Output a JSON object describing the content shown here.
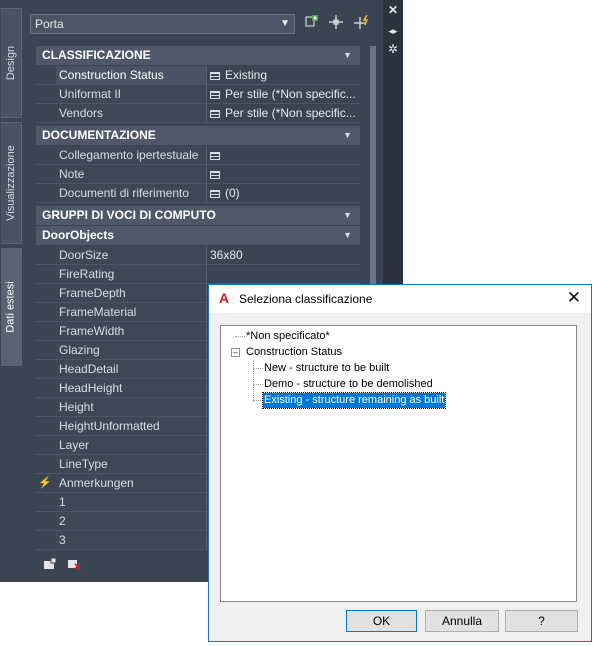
{
  "palette": {
    "tabs": [
      "Design",
      "Visualizzazione",
      "Dati estesi"
    ],
    "object_type": "Porta",
    "toolbar_icons": [
      "add-style-icon",
      "select-objects-icon",
      "quick-select-icon"
    ],
    "strip_icons": [
      "close-icon",
      "auto-hide-icon",
      "properties-icon"
    ],
    "categories": {
      "classificazione": "CLASSIFICAZIONE",
      "documentazione": "DOCUMENTAZIONE",
      "gruppi": "GRUPPI DI VOCI DI COMPUTO",
      "doorobjects": "DoorObjects"
    },
    "classificazione_rows": [
      {
        "name": "Construction Status",
        "value": "Existing"
      },
      {
        "name": "Uniformat II",
        "value": "Per stile (*Non specific..."
      },
      {
        "name": "Vendors",
        "value": "Per stile (*Non specific..."
      }
    ],
    "documentazione_rows": [
      {
        "name": "Collegamento ipertestuale",
        "value": ""
      },
      {
        "name": "Note",
        "value": ""
      },
      {
        "name": "Documenti di riferimento",
        "value": "(0)"
      }
    ],
    "door_rows": [
      {
        "name": "DoorSize",
        "value": "36x80"
      },
      {
        "name": "FireRating",
        "value": ""
      },
      {
        "name": "FrameDepth",
        "value": ""
      },
      {
        "name": "FrameMaterial",
        "value": ""
      },
      {
        "name": "FrameWidth",
        "value": ""
      },
      {
        "name": "Glazing",
        "value": ""
      },
      {
        "name": "HeadDetail",
        "value": ""
      },
      {
        "name": "HeadHeight",
        "value": ""
      },
      {
        "name": "Height",
        "value": ""
      },
      {
        "name": "HeightUnformatted",
        "value": ""
      },
      {
        "name": "Layer",
        "value": ""
      },
      {
        "name": "LineType",
        "value": ""
      },
      {
        "name": "Anmerkungen",
        "value": ""
      },
      {
        "name": "1",
        "value": ""
      },
      {
        "name": "2",
        "value": ""
      },
      {
        "name": "3",
        "value": ""
      }
    ]
  },
  "dialog": {
    "title": "Seleziona classificazione",
    "tree": {
      "unspecified": "*Non specificato*",
      "root": "Construction Status",
      "children": [
        "New - structure to be built",
        "Demo - structure to be demolished",
        "Existing - structure remaining as built"
      ],
      "selected_index": 2
    },
    "buttons": {
      "ok": "OK",
      "cancel": "Annulla",
      "help": "?"
    }
  }
}
